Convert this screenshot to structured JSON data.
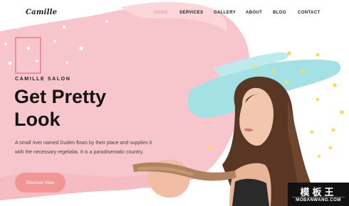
{
  "brand": {
    "logo_text": "Camille"
  },
  "nav": {
    "items": [
      {
        "label": "HOME",
        "active": true
      },
      {
        "label": "SERVICES",
        "active": false
      },
      {
        "label": "GALLERY",
        "active": false
      },
      {
        "label": "ABOUT",
        "active": false
      },
      {
        "label": "BLOG",
        "active": false
      },
      {
        "label": "CONTACT",
        "active": false
      }
    ]
  },
  "hero": {
    "eyebrow": "CAMILLE SALON",
    "headline_line1": "Get Pretty",
    "headline_line2": "Look",
    "description": "A small river named Duden flows by their place and supplies it with the necessary regelialia. It is a paradisematic country.",
    "cta_label": "Discover Now"
  },
  "watermark": {
    "title": "模板王",
    "subtitle": "MOBANWANG.COM"
  },
  "colors": {
    "accent_pink": "#f29596",
    "brush_pink": "#f7c3c9",
    "brush_teal": "#9fe0e4",
    "dot_yellow": "#f3df63",
    "nav_active": "#f1a3a8"
  }
}
